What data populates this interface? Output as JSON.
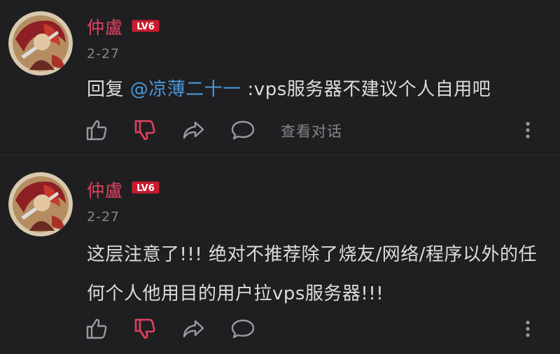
{
  "comments": [
    {
      "user": {
        "name": "仲盧",
        "level_badge": "LV6"
      },
      "date": "2-27",
      "reply_prefix": "回复 ",
      "mention": "@凉薄二十一",
      "text_after_mention": " :vps服务器不建议个人自用吧",
      "actions": {
        "view_conversation": "查看对话"
      }
    },
    {
      "user": {
        "name": "仲盧",
        "level_badge": "LV6"
      },
      "date": "2-27",
      "text": "这层注意了!!! 绝对不推荐除了烧友/网络/程序以外的任何个人他用目的用户拉vps服务器!!!"
    }
  ],
  "icons": {
    "like": "thumbs-up-icon",
    "dislike": "thumbs-down-icon",
    "share": "share-icon",
    "reply": "comment-icon",
    "more": "more-vertical-icon"
  },
  "colors": {
    "background": "#1f1f21",
    "username": "#e0425e",
    "mention": "#4c97d8",
    "dislike_active": "#e0425e",
    "muted": "#85858a",
    "body_text": "#dcdcdc"
  }
}
